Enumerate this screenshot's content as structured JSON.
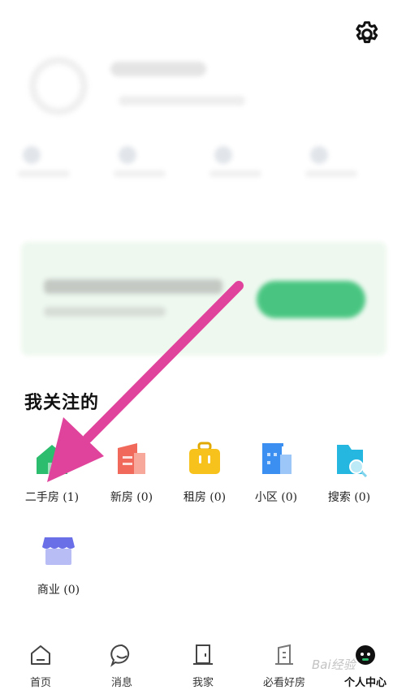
{
  "header": {
    "settings_icon": "gear-icon"
  },
  "favorites": {
    "title": "我关注的",
    "items": [
      {
        "label": "二手房 (1)",
        "icon": "house-icon",
        "color": "#2dbd6e"
      },
      {
        "label": "新房 (0)",
        "icon": "building-icon",
        "color": "#f0695a"
      },
      {
        "label": "租房 (0)",
        "icon": "suitcase-icon",
        "color": "#f7c21b"
      },
      {
        "label": "小区 (0)",
        "icon": "community-icon",
        "color": "#3b8ff0"
      },
      {
        "label": "搜索 (0)",
        "icon": "search-folder-icon",
        "color": "#25b7e0"
      },
      {
        "label": "商业 (0)",
        "icon": "shop-icon",
        "color": "#7b7ff0"
      }
    ]
  },
  "tabbar": {
    "items": [
      {
        "label": "首页",
        "icon": "home-icon"
      },
      {
        "label": "消息",
        "icon": "message-icon"
      },
      {
        "label": "我家",
        "icon": "door-icon"
      },
      {
        "label": "必看好房",
        "icon": "building-door-icon"
      },
      {
        "label": "个人中心",
        "icon": "person-icon",
        "active": true
      }
    ]
  },
  "colors": {
    "accent": "#2dbd6e",
    "arrow": "#e0439b"
  },
  "watermark": "Bai经验"
}
